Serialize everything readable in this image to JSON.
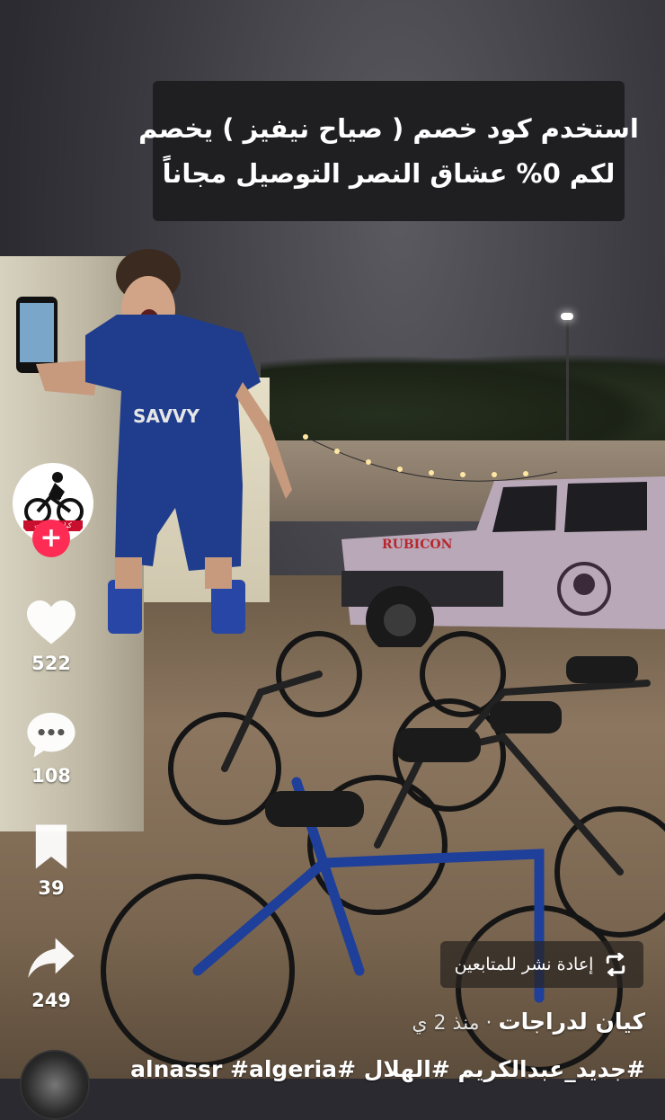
{
  "caption": {
    "line1": "استخدم كود خصم ( صياح نيفيز ) يخصم",
    "line2": "لكم 0% عشاق النصر التوصيل مجاناً"
  },
  "creator": {
    "avatar_label": "كيان دراجات"
  },
  "actions": {
    "like_count": "522",
    "comment_count": "108",
    "save_count": "39",
    "share_count": "249"
  },
  "repost": {
    "label": "إعادة نشر للمتابعين"
  },
  "post": {
    "author": "كيان لدراجات",
    "separator": " · ",
    "time_ago": "منذ 2 ي",
    "hashtags": "#جديد_عبدالكريم #الهلال #alnassr #algeria"
  },
  "colors": {
    "follow_accent": "#fe2c55",
    "caption_bg": "#1f1f22"
  },
  "icons": [
    "heart-icon",
    "comment-icon",
    "bookmark-icon",
    "share-icon",
    "repost-icon",
    "plus-icon"
  ]
}
